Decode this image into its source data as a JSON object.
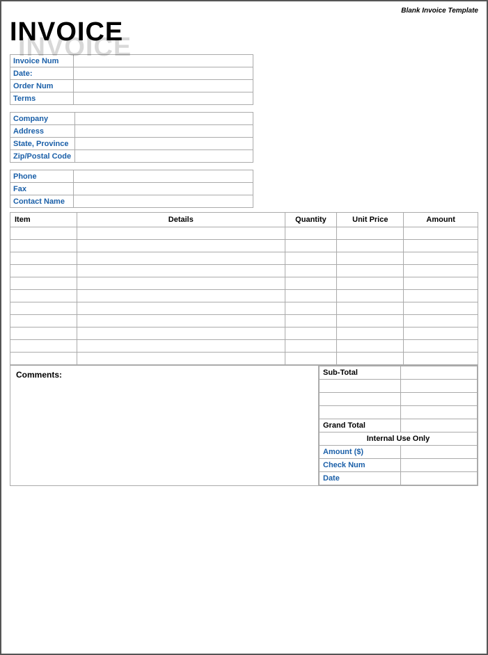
{
  "header": {
    "template_label": "Blank Invoice Template",
    "title_bg": "INVOICE",
    "title": "INVOICE"
  },
  "info_block1": {
    "rows": [
      {
        "label": "Invoice Num",
        "value": ""
      },
      {
        "label": "Date:",
        "value": ""
      },
      {
        "label": "Order Num",
        "value": ""
      },
      {
        "label": "Terms",
        "value": ""
      }
    ]
  },
  "info_block2": {
    "rows": [
      {
        "label": "Company",
        "value": ""
      },
      {
        "label": "Address",
        "value": ""
      },
      {
        "label": "State, Province",
        "value": ""
      },
      {
        "label": "Zip/Postal Code",
        "value": ""
      }
    ]
  },
  "info_block3": {
    "rows": [
      {
        "label": "Phone",
        "value": ""
      },
      {
        "label": "Fax",
        "value": ""
      },
      {
        "label": "Contact Name",
        "value": ""
      }
    ]
  },
  "items_table": {
    "headers": {
      "item": "Item",
      "details": "Details",
      "quantity": "Quantity",
      "unit_price": "Unit Price",
      "amount": "Amount"
    },
    "rows": [
      {},
      {},
      {},
      {},
      {},
      {},
      {},
      {},
      {},
      {},
      {}
    ]
  },
  "comments": {
    "label": "Comments:"
  },
  "totals": {
    "subtotal_label": "Sub-Total",
    "grand_total_label": "Grand Total",
    "internal_use_label": "Internal Use Only",
    "amount_label": "Amount ($)",
    "check_num_label": "Check Num",
    "date_label": "Date",
    "rows": [
      {
        "label": "Sub-Total",
        "value": ""
      },
      {
        "label": "",
        "value": ""
      },
      {
        "label": "",
        "value": ""
      },
      {
        "label": "",
        "value": ""
      }
    ]
  }
}
